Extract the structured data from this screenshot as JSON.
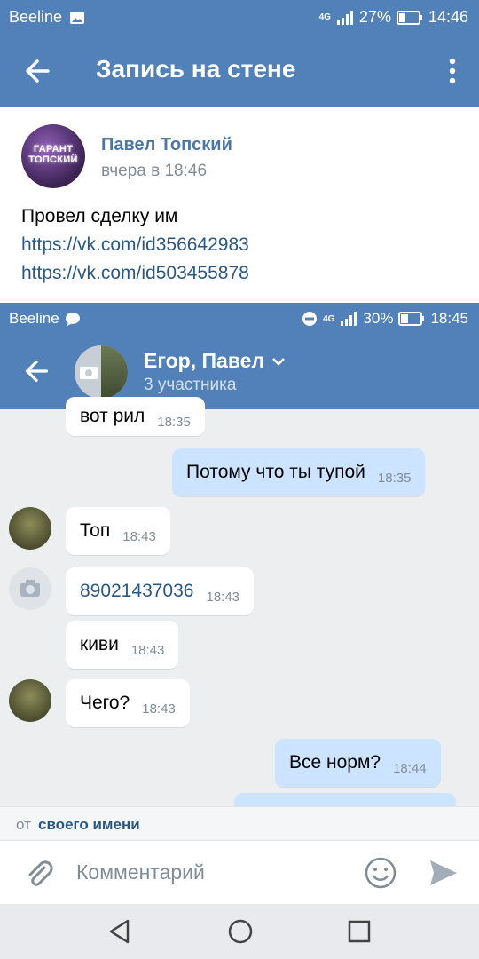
{
  "status_bar": {
    "carrier": "Beeline",
    "network": "4G",
    "battery": "27%",
    "time": "14:46"
  },
  "toolbar": {
    "title": "Запись на стене",
    "back_icon": "arrow-left-icon",
    "menu_icon": "more-vertical-icon"
  },
  "post": {
    "avatar_text": "ГАРАНТ ТОПСКИЙ",
    "author": "Павел Топский",
    "date": "вчера в 18:46",
    "text": "Провел сделку им",
    "links": [
      "https://vk.com/id356642983",
      "https://vk.com/id503455878"
    ]
  },
  "screenshot": {
    "status_bar": {
      "carrier": "Beeline",
      "network": "4G",
      "battery": "30%",
      "time": "18:45"
    },
    "chat": {
      "title": "Егор, Павел",
      "subtitle": "3 участника"
    },
    "messages": [
      {
        "text": "вот рил",
        "time": "18:35",
        "side": "in"
      },
      {
        "text": "Потому что ты тупой",
        "time": "18:35",
        "side": "out"
      },
      {
        "text": "Топ",
        "time": "18:43",
        "side": "in"
      },
      {
        "text": "89021437036",
        "time": "18:43",
        "side": "in"
      },
      {
        "text": "киви",
        "time": "18:43",
        "side": "in"
      },
      {
        "text": "Чего?",
        "time": "18:43",
        "side": "in"
      },
      {
        "text": "Все норм?",
        "time": "18:44",
        "side": "out"
      }
    ]
  },
  "comment_from": {
    "prefix": "от",
    "value": "своего имени"
  },
  "comment_input": {
    "placeholder": "Комментарий"
  },
  "colors": {
    "header": "#5181b8",
    "link": "#2a5885",
    "out_bubble": "#cce4ff",
    "chat_bg": "#edeef0"
  }
}
